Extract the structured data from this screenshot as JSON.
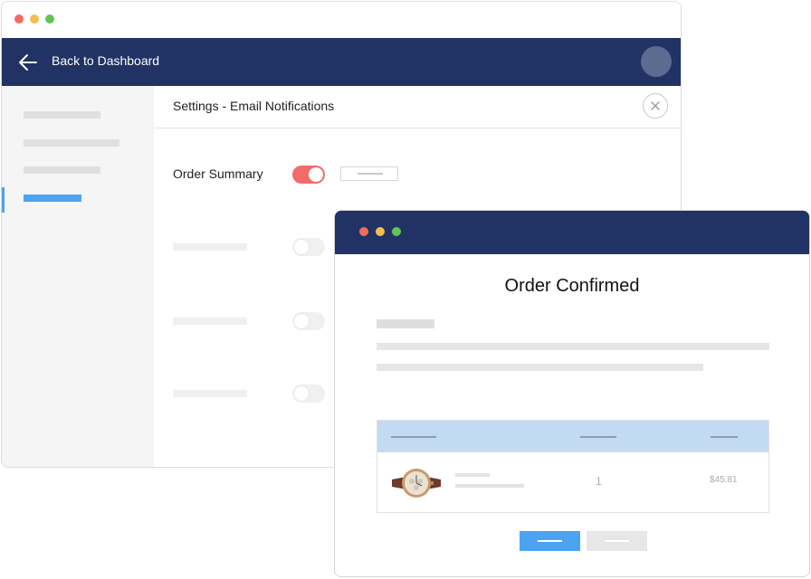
{
  "back_window": {
    "header": {
      "back_label": "Back to Dashboard"
    },
    "content": {
      "title": "Settings - Email Notifications",
      "rows": [
        {
          "label": "Order Summary",
          "toggle": "on"
        }
      ]
    }
  },
  "front_window": {
    "title": "Order Confirmed",
    "table": {
      "rows": [
        {
          "quantity": "1",
          "price": "$45.81"
        }
      ]
    }
  },
  "colors": {
    "navy": "#213264",
    "accent_blue": "#4ca3f1",
    "toggle_on": "#f26b6b",
    "table_header": "#c2daf2"
  }
}
